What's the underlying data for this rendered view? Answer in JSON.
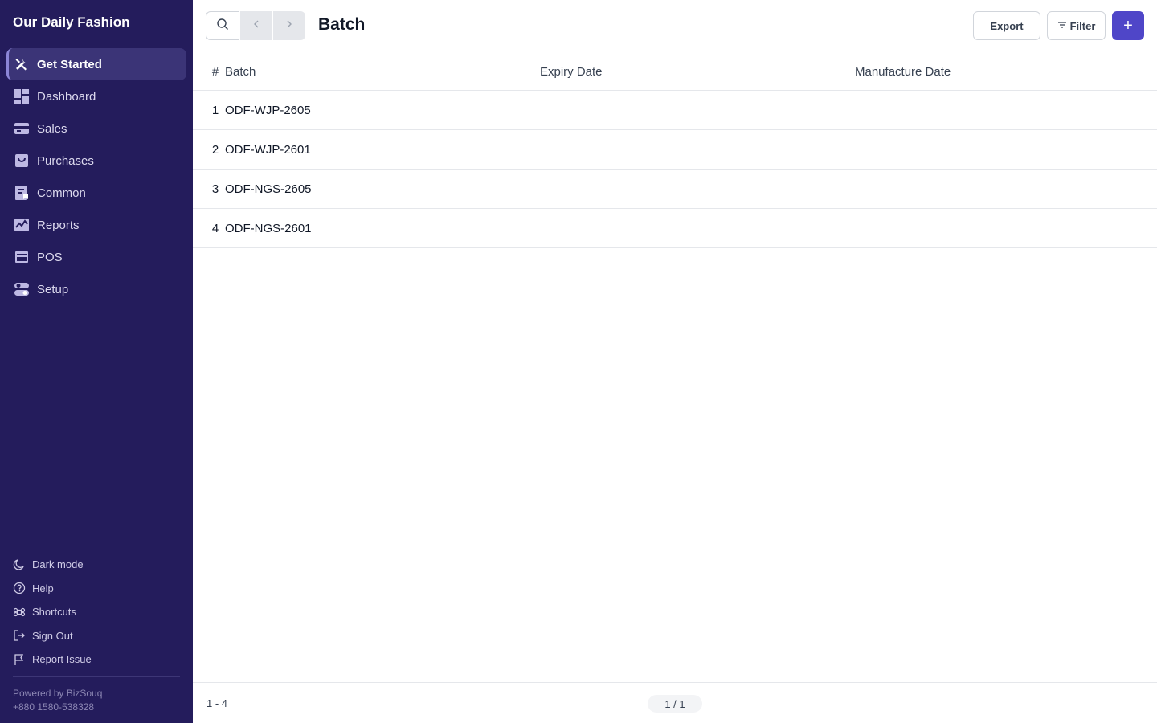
{
  "sidebar": {
    "company": "Our Daily Fashion",
    "items": [
      {
        "label": "Get Started",
        "icon": "tools-icon"
      },
      {
        "label": "Dashboard",
        "icon": "dashboard-icon"
      },
      {
        "label": "Sales",
        "icon": "sales-icon"
      },
      {
        "label": "Purchases",
        "icon": "purchases-icon"
      },
      {
        "label": "Common",
        "icon": "common-icon"
      },
      {
        "label": "Reports",
        "icon": "reports-icon"
      },
      {
        "label": "POS",
        "icon": "pos-icon"
      },
      {
        "label": "Setup",
        "icon": "setup-icon"
      }
    ],
    "bottom": [
      {
        "label": "Dark mode",
        "icon": "moon-icon"
      },
      {
        "label": "Help",
        "icon": "help-icon"
      },
      {
        "label": "Shortcuts",
        "icon": "command-icon"
      },
      {
        "label": "Sign Out",
        "icon": "sign-out-icon"
      },
      {
        "label": "Report Issue",
        "icon": "flag-icon"
      }
    ],
    "powered_by": "Powered by BizSouq",
    "phone": "+880 1580-538328"
  },
  "header": {
    "title": "Batch",
    "export_label": "Export",
    "filter_label": "Filter",
    "add_label": "+"
  },
  "table": {
    "columns": {
      "num": "#",
      "batch": "Batch",
      "expiry": "Expiry Date",
      "manufacture": "Manufacture Date"
    },
    "rows": [
      {
        "num": "1",
        "batch": "ODF-WJP-2605",
        "expiry": "",
        "manufacture": ""
      },
      {
        "num": "2",
        "batch": "ODF-WJP-2601",
        "expiry": "",
        "manufacture": ""
      },
      {
        "num": "3",
        "batch": "ODF-NGS-2605",
        "expiry": "",
        "manufacture": ""
      },
      {
        "num": "4",
        "batch": "ODF-NGS-2601",
        "expiry": "",
        "manufacture": ""
      }
    ]
  },
  "footer": {
    "range": "1 - 4",
    "page": "1 / 1"
  },
  "colors": {
    "sidebar_bg": "#241c5c",
    "sidebar_active": "#3b3477",
    "accent": "#4f46c8"
  }
}
